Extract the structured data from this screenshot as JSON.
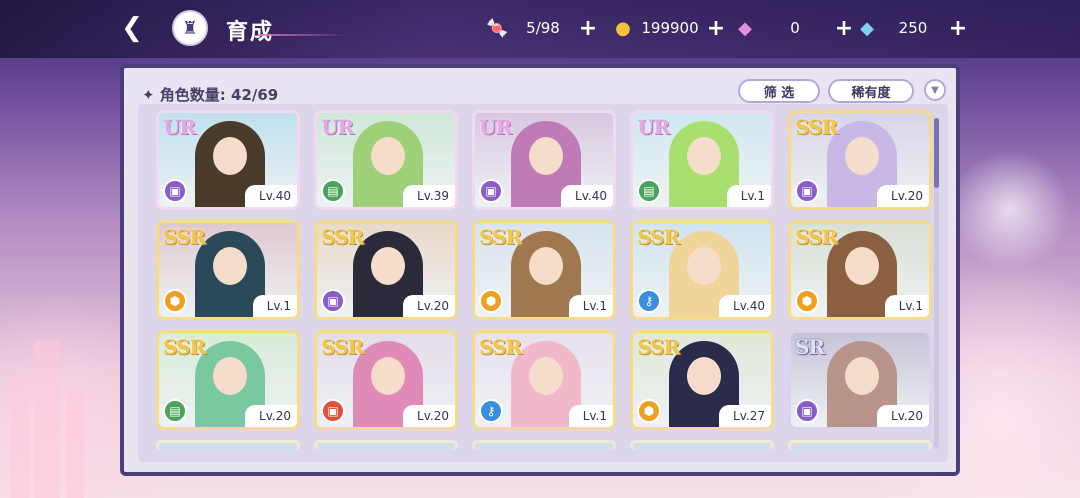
{
  "header": {
    "title": "育成",
    "back_icon": "back-arrow-icon",
    "home_icon": "castle-home-icon"
  },
  "resources": [
    {
      "icon": "candy-icon",
      "glyph": "🍬",
      "value": "5/98",
      "plus": "+"
    },
    {
      "icon": "gold-coin-icon",
      "glyph": "●",
      "value": "199900",
      "plus": "+"
    },
    {
      "icon": "pink-diamond-icon",
      "glyph": "◆",
      "value": "0",
      "plus": "+"
    },
    {
      "icon": "blue-diamond-icon",
      "glyph": "◆",
      "value": "250",
      "plus": "+"
    }
  ],
  "panel": {
    "count_label": "✦ 角色数量: 42/69",
    "filter_label": "筛 选",
    "sort_label": "稀有度",
    "dropdown_glyph": "▼"
  },
  "colors": {
    "ur": "#e6a6e8",
    "ssr": "#f4c642",
    "sr": "#dfe2f6",
    "panel_border": "#4b3e78"
  },
  "cards": [
    {
      "rarity": "UR",
      "level": "Lv.40",
      "type": "purple"
    },
    {
      "rarity": "UR",
      "level": "Lv.39",
      "type": "green"
    },
    {
      "rarity": "UR",
      "level": "Lv.40",
      "type": "purple"
    },
    {
      "rarity": "UR",
      "level": "Lv.1",
      "type": "green"
    },
    {
      "rarity": "SSR",
      "level": "Lv.20",
      "type": "purple"
    },
    {
      "rarity": "SSR",
      "level": "Lv.1",
      "type": "orange"
    },
    {
      "rarity": "SSR",
      "level": "Lv.20",
      "type": "purple"
    },
    {
      "rarity": "SSR",
      "level": "Lv.1",
      "type": "orange"
    },
    {
      "rarity": "SSR",
      "level": "Lv.40",
      "type": "blue"
    },
    {
      "rarity": "SSR",
      "level": "Lv.1",
      "type": "orange"
    },
    {
      "rarity": "SSR",
      "level": "Lv.20",
      "type": "green"
    },
    {
      "rarity": "SSR",
      "level": "Lv.20",
      "type": "red"
    },
    {
      "rarity": "SSR",
      "level": "Lv.1",
      "type": "blue"
    },
    {
      "rarity": "SSR",
      "level": "Lv.27",
      "type": "orange"
    },
    {
      "rarity": "SR",
      "level": "Lv.20",
      "type": "purple"
    }
  ]
}
